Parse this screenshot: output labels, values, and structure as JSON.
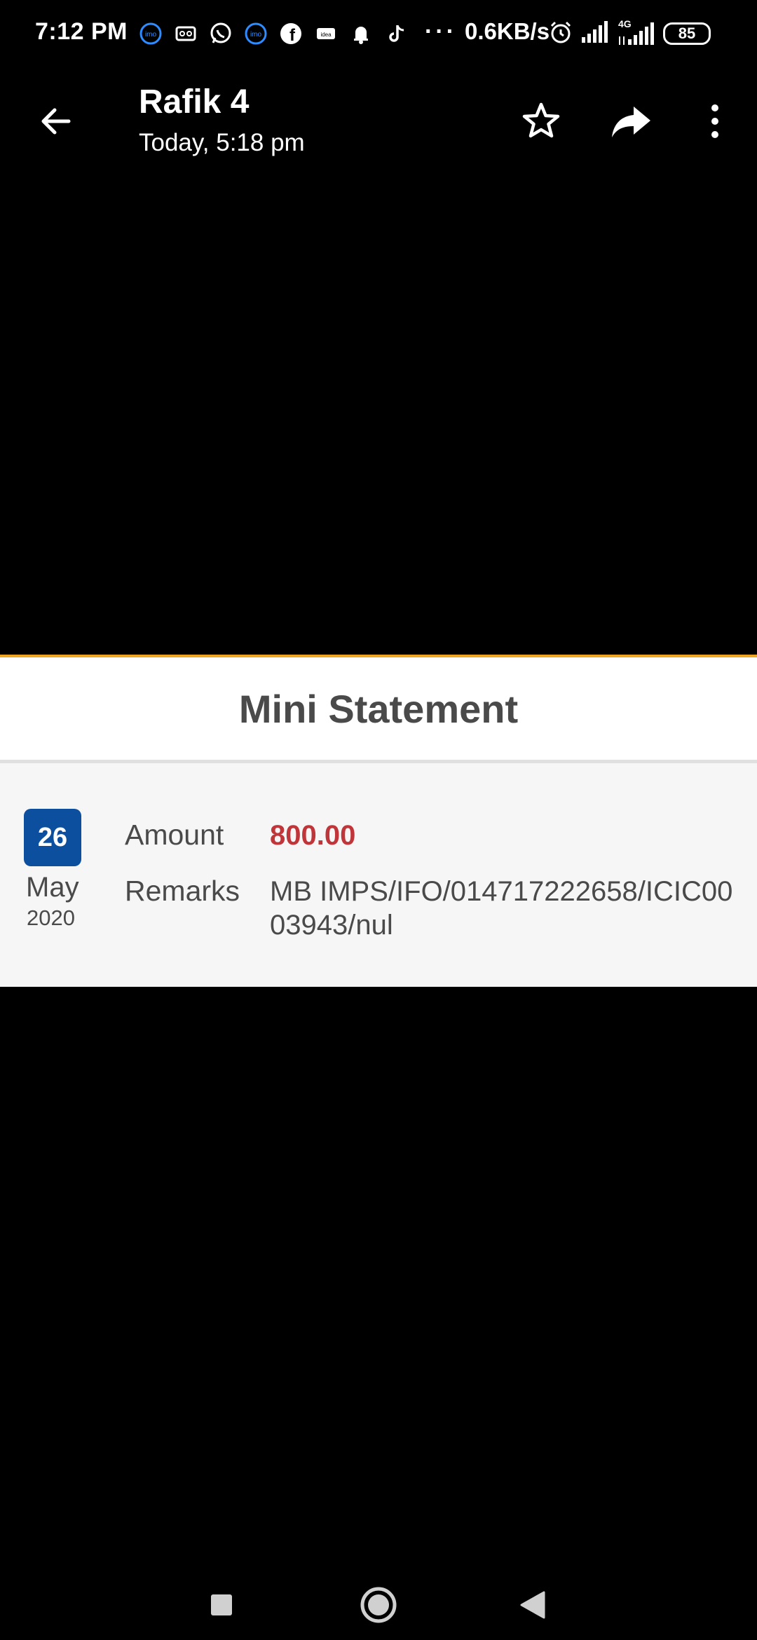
{
  "status_bar": {
    "time": "7:12 PM",
    "dots": "···",
    "speed": "0.6KB/s",
    "network_label": "4G",
    "battery": "85",
    "notification_icons": [
      "imo-icon",
      "voicemail-icon",
      "whatsapp-icon",
      "imo-icon",
      "facebook-icon",
      "idea-icon",
      "bell-icon",
      "tiktok-icon"
    ]
  },
  "header": {
    "title": "Rafik 4",
    "subtitle": "Today, 5:18 pm",
    "icons": [
      "back-arrow-icon",
      "star-icon",
      "forward-icon",
      "more-vertical-icon"
    ]
  },
  "statement": {
    "title": "Mini Statement",
    "date": {
      "day": "26",
      "month": "May",
      "year": "2020"
    },
    "amount_label": "Amount",
    "amount_value": "800.00",
    "remarks_label": "Remarks",
    "remarks_value": "MB IMPS/IFO/014717222658/ICIC0003943/nul"
  },
  "colors": {
    "accent_orange": "#f0a623",
    "date_blue": "#0c4f9e",
    "amount_red": "#c0353a",
    "text_gray": "#4a4a4a"
  },
  "nav": {
    "icons": [
      "recents-square-icon",
      "home-circle-icon",
      "back-triangle-icon"
    ]
  }
}
